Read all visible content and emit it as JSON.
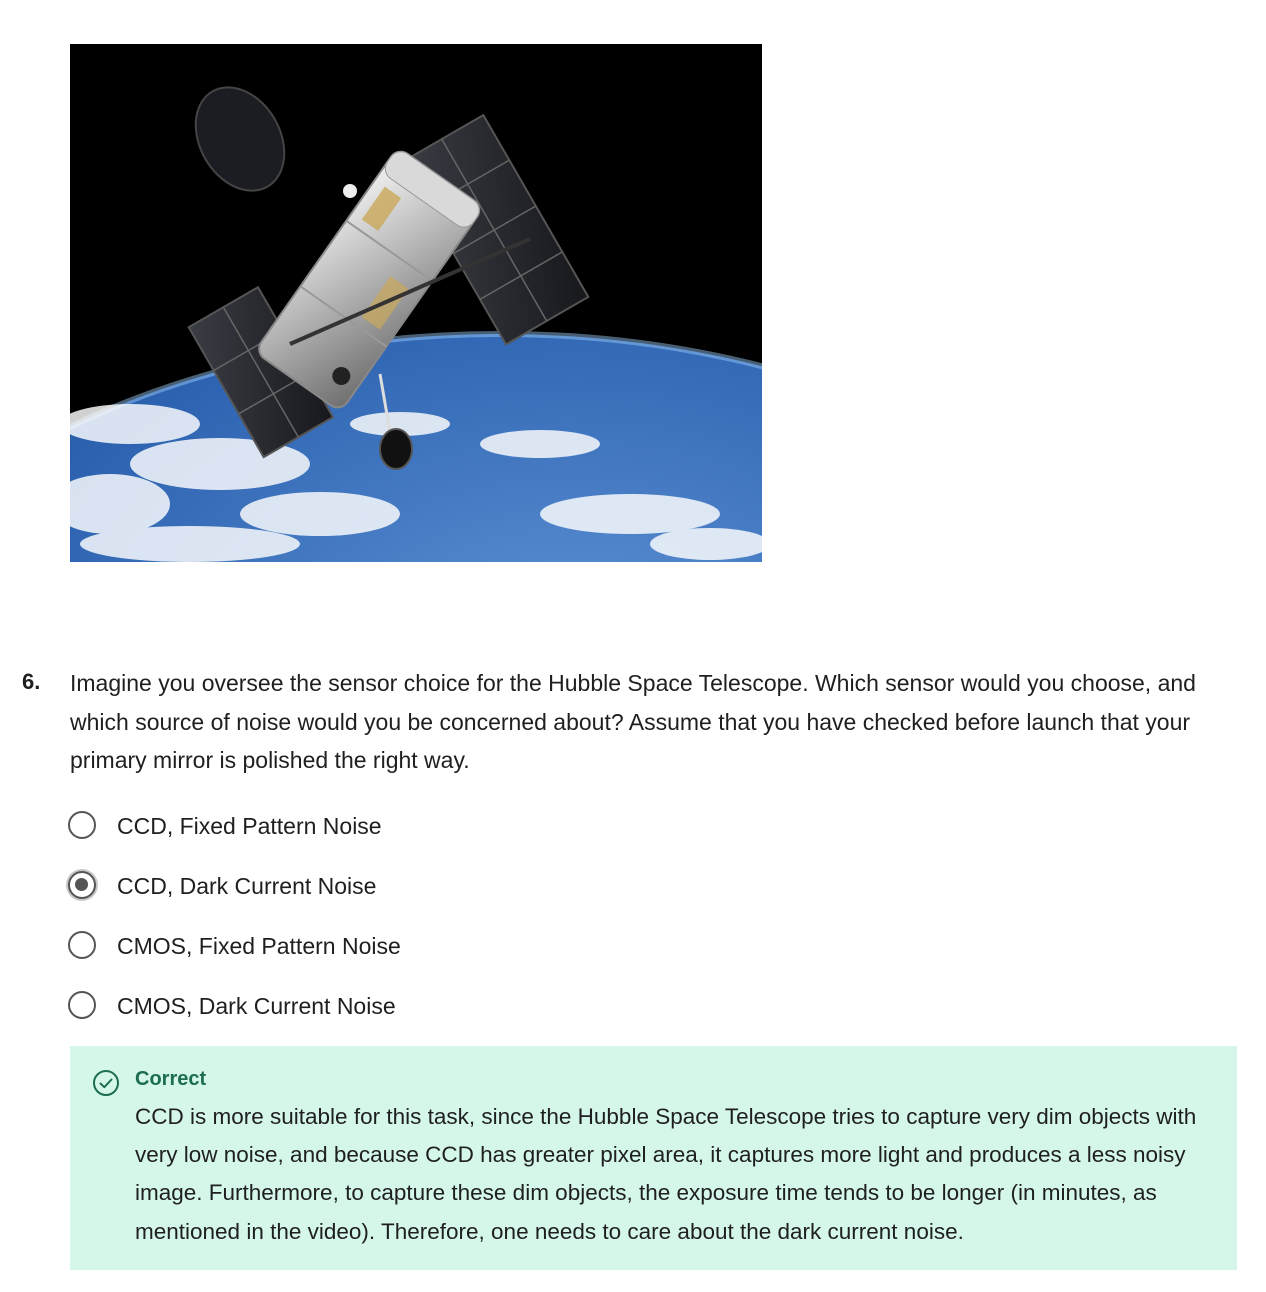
{
  "figure": {
    "alt": "hubble-telescope-over-earth-image"
  },
  "question": {
    "number": "6.",
    "text": "Imagine you oversee the sensor choice for the Hubble Space Telescope. Which sensor would you choose, and which source of noise would you be concerned about? Assume that you have checked before launch that your primary mirror is polished the right way.",
    "options": [
      {
        "label": "CCD, Fixed Pattern Noise",
        "selected": false
      },
      {
        "label": "CCD, Dark Current Noise",
        "selected": true
      },
      {
        "label": "CMOS, Fixed Pattern Noise",
        "selected": false
      },
      {
        "label": "CMOS, Dark Current Noise",
        "selected": false
      }
    ]
  },
  "feedback": {
    "status": "Correct",
    "icon": "check-circle-icon",
    "explanation": "CCD is more suitable for this task, since the Hubble Space Telescope tries to capture very dim objects with very low noise, and because CCD has greater pixel area, it captures more light and produces a less noisy image. Furthermore, to capture these dim objects, the exposure time tends to be longer (in minutes, as mentioned in the video). Therefore, one needs to care about the dark current noise.",
    "colors": {
      "background": "#d5f7ea",
      "accent": "#1d6e4e"
    }
  }
}
